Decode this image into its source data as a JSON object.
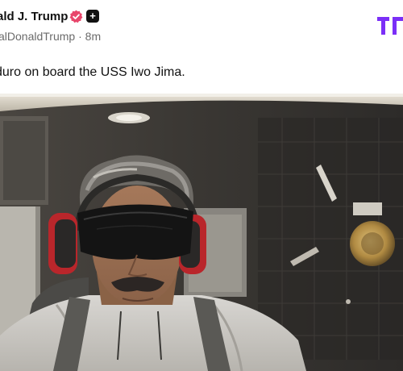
{
  "post": {
    "author": {
      "display_name": "ald J. Trump",
      "handle": "alDonaldTrump",
      "separator": "·",
      "time": "8m",
      "badges": [
        "verified-check-icon",
        "plus-badge-icon"
      ],
      "badge_plus_glyph": "+"
    },
    "brand": {
      "logo": "truth-social-logo",
      "color": "#7b2ff7"
    },
    "text": "duro on board the USS Iwo Jima.",
    "media": {
      "type": "photo",
      "icon": "photo-image",
      "subject": "man wearing blackout goggles and ear defenders"
    }
  },
  "colors": {
    "verified": "#e8466b",
    "text_primary": "#111111",
    "text_secondary": "#6b6b6b",
    "background": "#ffffff"
  }
}
